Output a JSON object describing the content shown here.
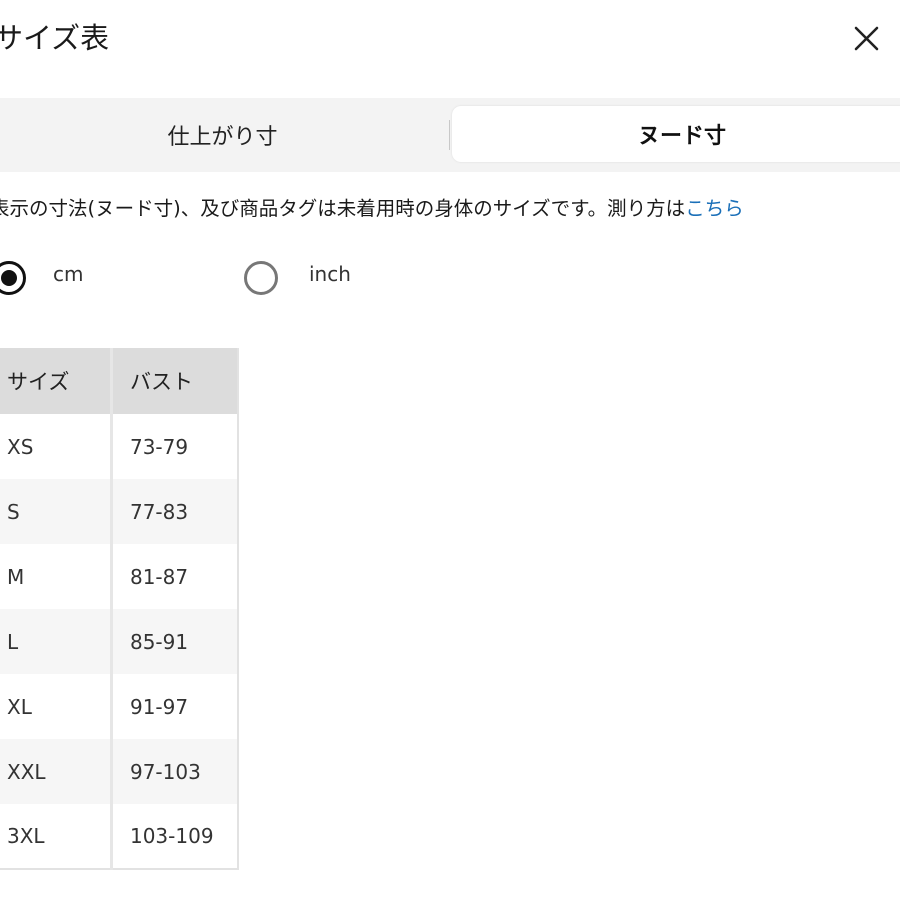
{
  "header": {
    "title": "サイズ表",
    "close_icon": "close-icon"
  },
  "tabs": [
    {
      "label": "仕上がり寸",
      "active": false
    },
    {
      "label": "ヌード寸",
      "active": true
    }
  ],
  "note": {
    "text": "表示の寸法(ヌード寸)、及び商品タグは未着用時の身体のサイズです。測り方は",
    "link_text": "こちら",
    "link_color": "#1a6fb8"
  },
  "units": {
    "selected": "cm",
    "options": [
      {
        "label": "cm",
        "checked": true
      },
      {
        "label": "inch",
        "checked": false
      }
    ]
  },
  "table": {
    "headers": [
      "サイズ",
      "バスト"
    ],
    "rows": [
      [
        "XS",
        "73-79"
      ],
      [
        "S",
        "77-83"
      ],
      [
        "M",
        "81-87"
      ],
      [
        "L",
        "85-91"
      ],
      [
        "XL",
        "91-97"
      ],
      [
        "XXL",
        "97-103"
      ],
      [
        "3XL",
        "103-109"
      ]
    ]
  }
}
